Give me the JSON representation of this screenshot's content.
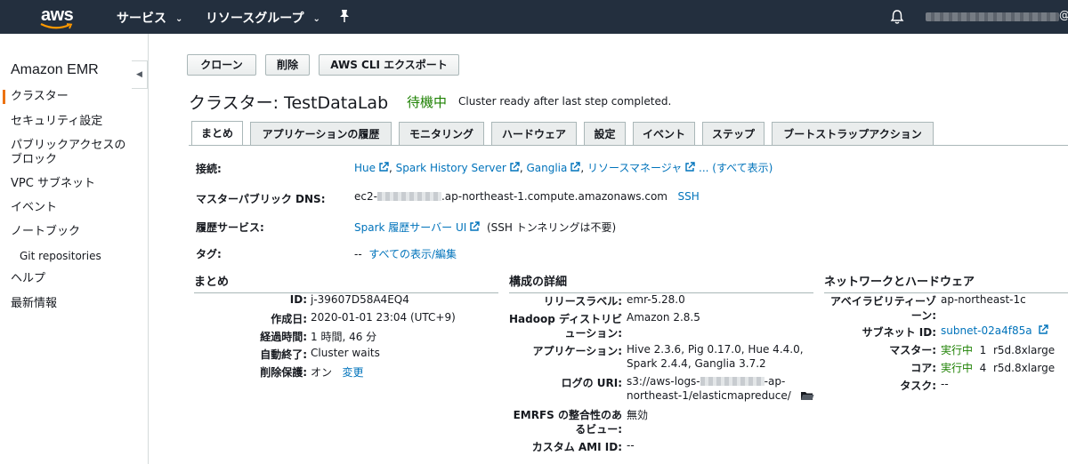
{
  "topnav": {
    "logo": "aws",
    "services": "サービス",
    "resource_groups": "リソースグループ",
    "icons": [
      "pin-icon",
      "bell-icon"
    ],
    "account_suffix": "@"
  },
  "sidebar": {
    "title": "Amazon EMR",
    "items": [
      {
        "label": "クラスター",
        "active": true
      },
      {
        "label": "セキュリティ設定"
      },
      {
        "label": "パブリックアクセスの"
      },
      {
        "label": "ブロック"
      },
      {
        "label": "VPC サブネット"
      },
      {
        "label": "イベント"
      },
      {
        "label": "ノートブック"
      },
      {
        "label": "Git repositories"
      },
      {
        "label": "ヘルプ"
      },
      {
        "label": "最新情報"
      }
    ]
  },
  "actions": {
    "clone": "クローン",
    "delete": "削除",
    "cli_export": "AWS CLI エクスポート"
  },
  "cluster": {
    "title": "クラスター: TestDataLab",
    "status": "待機中",
    "status_message": "Cluster ready after last step completed.",
    "status_color": "#1d8102"
  },
  "tabs": [
    "まとめ",
    "アプリケーションの履歴",
    "モニタリング",
    "ハードウェア",
    "設定",
    "イベント",
    "ステップ",
    "ブートストラップアクション"
  ],
  "details": {
    "connections_label": "接続:",
    "connections": {
      "hue": "Hue",
      "spark_history": "Spark History Server",
      "ganglia": "Ganglia",
      "resource_manager": "リソースマネージャ",
      "more": "... (すべて表示)"
    },
    "master_dns_label": "マスターパブリック DNS:",
    "master_dns_prefix": "ec2-",
    "master_dns_suffix": ".ap-northeast-1.compute.amazonaws.com",
    "ssh": "SSH",
    "history_label": "履歴サービス:",
    "history_link": "Spark 履歴サーバー UI",
    "history_note": "(SSH トンネリングは不要)",
    "tags_label": "タグ:",
    "tags_value": "--",
    "tags_link": "すべての表示/編集"
  },
  "summary": {
    "heading": "まとめ",
    "id_label": "ID:",
    "id": "j-39607D58A4EQ4",
    "created_label": "作成日:",
    "created": "2020-01-01 23:04 (UTC+9)",
    "elapsed_label": "経過時間:",
    "elapsed": "1 時間, 46 分",
    "auto_term_label": "自動終了:",
    "auto_term": "Cluster waits",
    "term_protect_label": "削除保護:",
    "term_protect": "オン",
    "change": "変更"
  },
  "config": {
    "heading": "構成の詳細",
    "release_label": "リリースラベル:",
    "release": "emr-5.28.0",
    "hadoop_label_1": "Hadoop ディストリビ",
    "hadoop_label_2": "ューション:",
    "hadoop": "Amazon 2.8.5",
    "apps_label": "アプリケーション:",
    "apps_1": "Hive 2.3.6, Pig 0.17.0, Hue 4.4.0,",
    "apps_2": "Spark 2.4.4, Ganglia 3.7.2",
    "log_label": "ログの URI:",
    "log_1_prefix": "s3://aws-logs-",
    "log_1_suffix": "-ap-",
    "log_2": "northeast-1/elasticmapreduce/",
    "emrfs_label_1": "EMRFS の整合性のあ",
    "emrfs_label_2": "るビュー:",
    "emrfs": "無効",
    "ami_label": "カスタム AMI ID:",
    "ami": "--"
  },
  "network": {
    "heading": "ネットワークとハードウェア",
    "az_label_1": "アベイラビリティーゾ",
    "az_label_2": "ーン:",
    "az": "ap-northeast-1c",
    "subnet_label": "サブネット ID:",
    "subnet": "subnet-02a4f85a",
    "master_label": "マスター:",
    "master_status": "実行中",
    "master_count": "1",
    "master_type": "r5d.8xlarge",
    "core_label": "コア:",
    "core_status": "実行中",
    "core_count": "4",
    "core_type": "r5d.8xlarge",
    "task_label": "タスク:",
    "task": "--"
  }
}
